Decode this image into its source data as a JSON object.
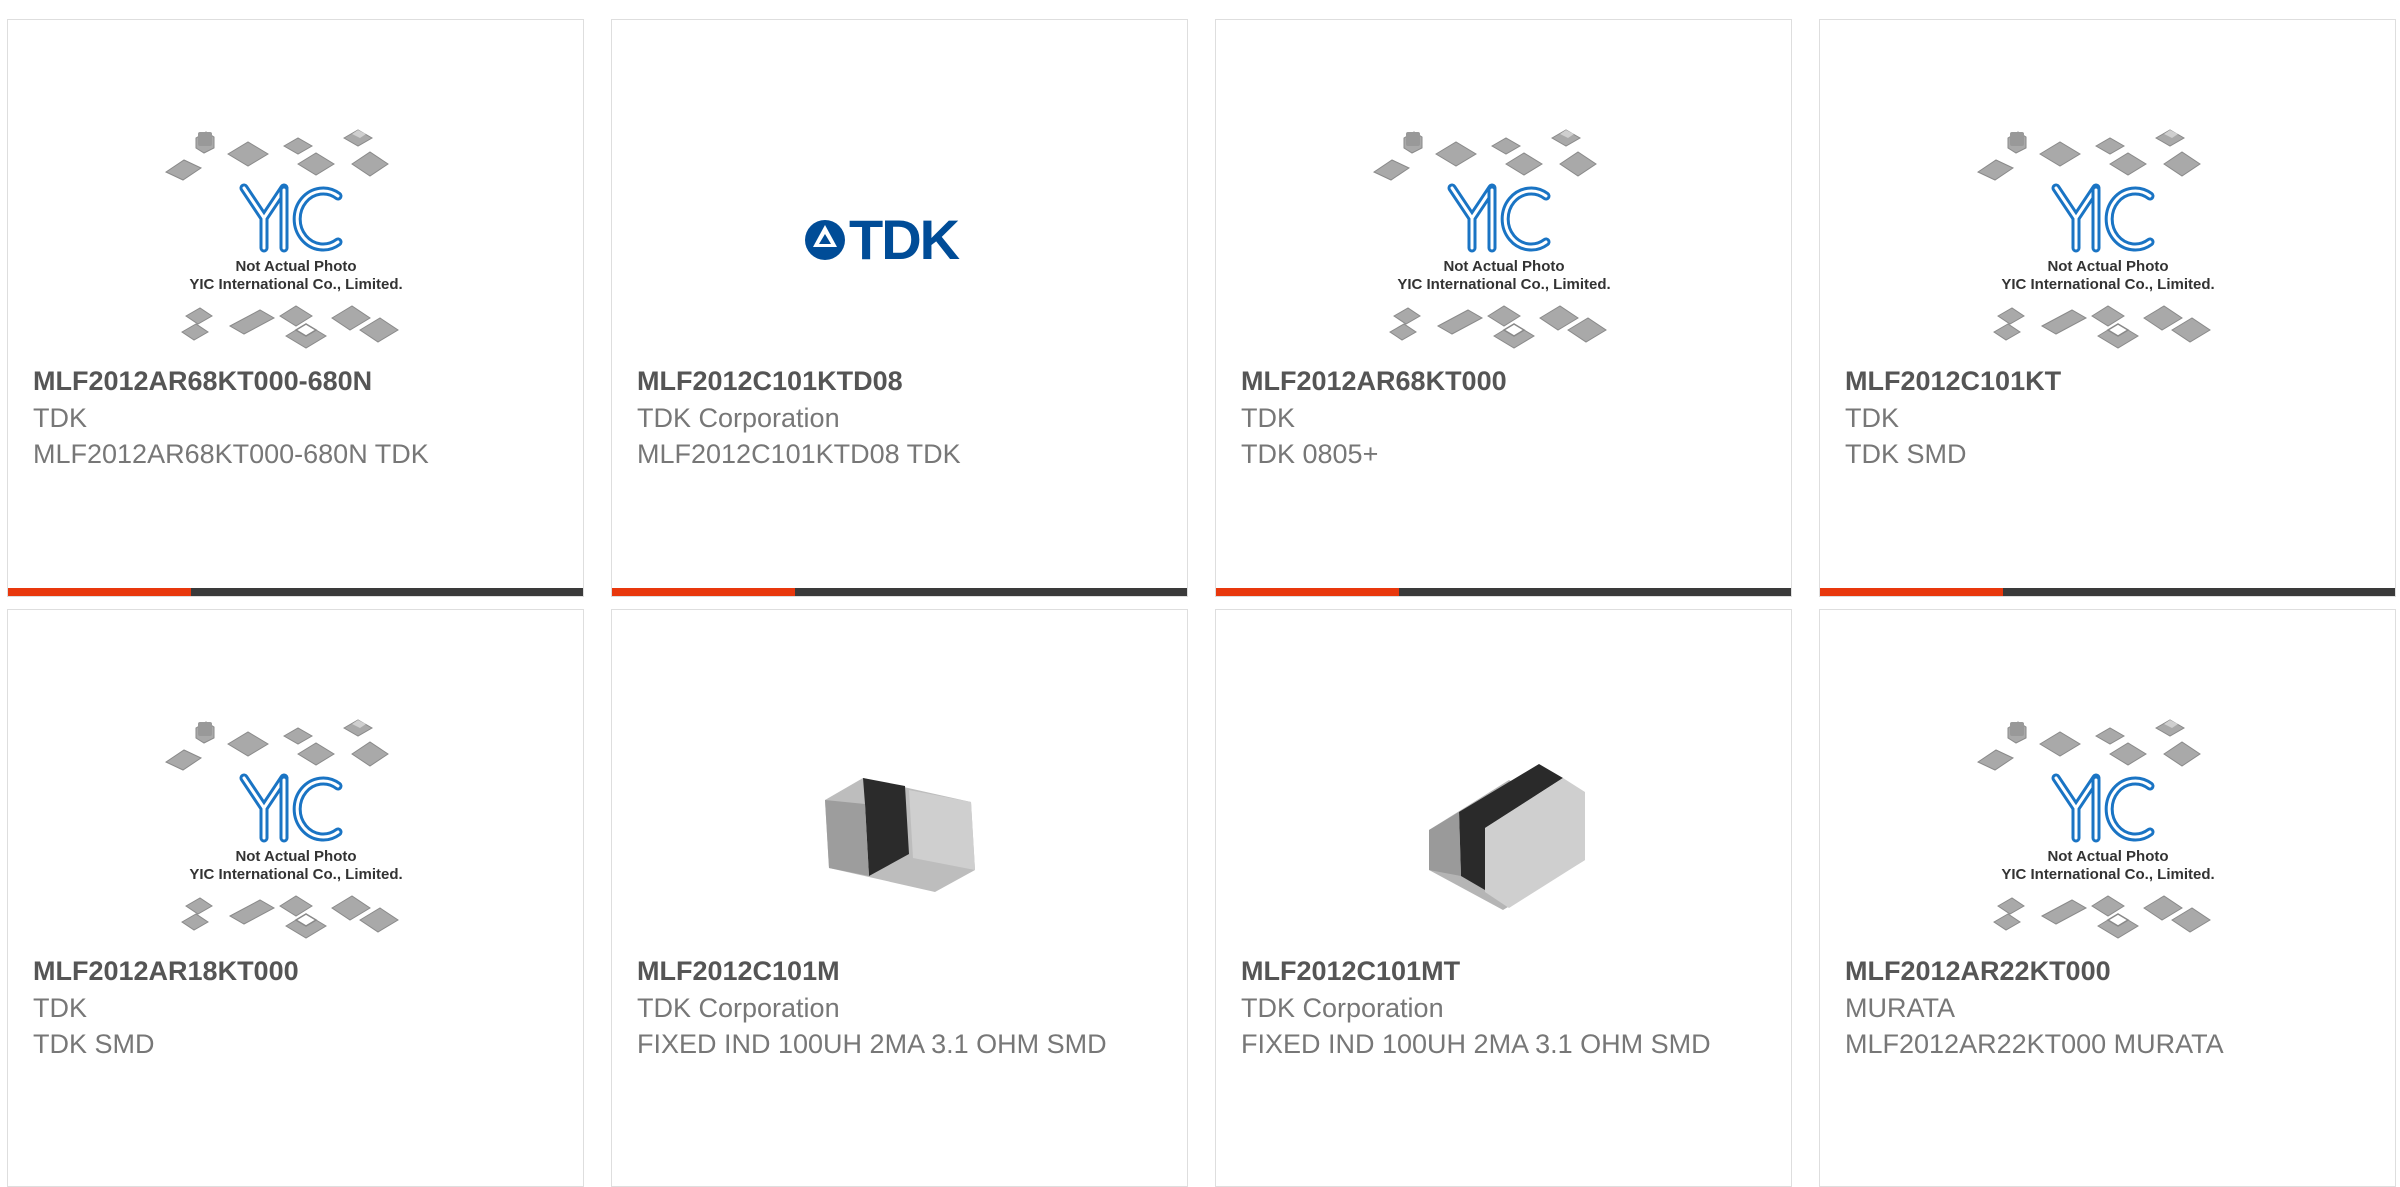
{
  "colors": {
    "accent": "#e8380d",
    "bar_dark": "#3a3a3a",
    "yic_blue": "#1a74c4",
    "tdk_blue": "#004c97"
  },
  "placeholder": {
    "line1": "Not Actual Photo",
    "line2": "YIC International Co., Limited."
  },
  "tdk_logo_text": "TDK",
  "products": [
    {
      "part": "MLF2012AR68KT000-680N",
      "mfr": "TDK",
      "desc": "MLF2012AR68KT000-680N TDK",
      "image": "yic-placeholder"
    },
    {
      "part": "MLF2012C101KTD08",
      "mfr": "TDK Corporation",
      "desc": "MLF2012C101KTD08 TDK",
      "image": "tdk-logo"
    },
    {
      "part": "MLF2012AR68KT000",
      "mfr": "TDK",
      "desc": "TDK 0805+",
      "image": "yic-placeholder"
    },
    {
      "part": "MLF2012C101KT",
      "mfr": "TDK",
      "desc": "TDK SMD",
      "image": "yic-placeholder"
    },
    {
      "part": "MLF2012AR18KT000",
      "mfr": "TDK",
      "desc": "TDK SMD",
      "image": "yic-placeholder"
    },
    {
      "part": "MLF2012C101M",
      "mfr": "TDK Corporation",
      "desc": "FIXED IND 100UH 2MA 3.1 OHM SMD",
      "image": "chip-photo"
    },
    {
      "part": "MLF2012C101MT",
      "mfr": "TDK Corporation",
      "desc": "FIXED IND 100UH 2MA 3.1 OHM SMD",
      "image": "chip-photo"
    },
    {
      "part": "MLF2012AR22KT000",
      "mfr": "MURATA",
      "desc": "MLF2012AR22KT000 MURATA",
      "image": "yic-placeholder"
    }
  ]
}
